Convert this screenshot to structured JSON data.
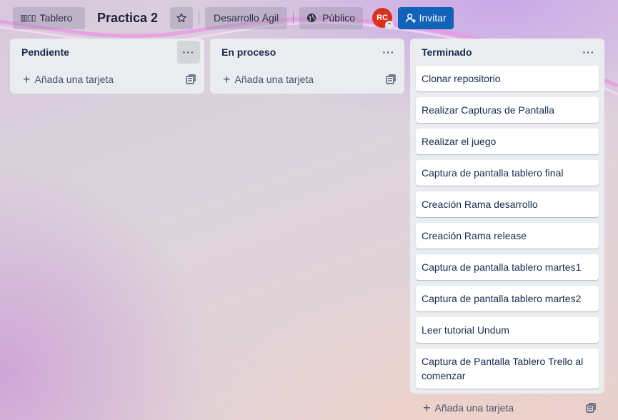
{
  "header": {
    "view_label": "Tablero",
    "board_title": "Practica 2",
    "workspace_label": "Desarrollo Ágil",
    "visibility_label": "Público",
    "avatar_initials": "RC",
    "invite_label": "Invitar"
  },
  "lists": [
    {
      "title": "Pendiente",
      "menu": "···",
      "add_card": "Añada una tarjeta",
      "cards": []
    },
    {
      "title": "En proceso",
      "menu": "···",
      "add_card": "Añada una tarjeta",
      "cards": []
    },
    {
      "title": "Terminado",
      "menu": "···",
      "add_card": "Añada una tarjeta",
      "cards": [
        "Clonar repositorio",
        "Realizar Capturas de Pantalla",
        "Realizar el juego",
        "Captura de pantalla tablero final",
        "Creación Rama desarrollo",
        "Creación Rama release",
        "Captura de pantalla tablero martes1",
        "Captura de pantalla tablero martes2",
        "Leer tutorial Undum",
        "Captura de Pantalla Tablero Trello al comenzar"
      ]
    }
  ],
  "colors": {
    "invite_bg": "#1262b8",
    "avatar_bg": "#d8331c",
    "list_bg": "#ebecf0"
  }
}
